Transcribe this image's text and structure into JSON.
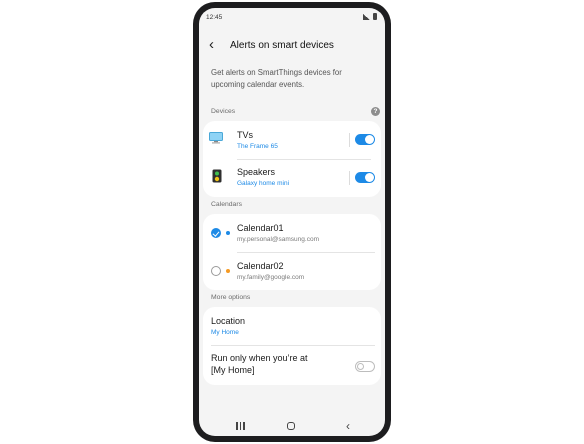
{
  "status_bar": {
    "time": "12:45"
  },
  "header": {
    "title": "Alerts on smart devices"
  },
  "description": "Get alerts on SmartThings devices for upcoming calendar events.",
  "devices": {
    "heading": "Devices",
    "items": [
      {
        "label": "TVs",
        "sub": "The Frame 65",
        "enabled": true
      },
      {
        "label": "Speakers",
        "sub": "Galaxy home mini",
        "enabled": true
      }
    ]
  },
  "calendars": {
    "heading": "Calendars",
    "items": [
      {
        "label": "Calendar01",
        "sub": "my.personal@samsung.com",
        "checked": true,
        "color": "#1d8ae6"
      },
      {
        "label": "Calendar02",
        "sub": "my.family@google.com",
        "checked": false,
        "color": "#f59a23"
      }
    ]
  },
  "more_options": {
    "heading": "More options",
    "location_label": "Location",
    "location_value": "My Home",
    "run_only_label_line1": "Run only when you’re at",
    "run_only_label_line2": "[My Home]",
    "run_only_enabled": false
  },
  "colors": {
    "accent": "#1d8ae6",
    "background": "#f4f4f4",
    "card": "#ffffff"
  }
}
